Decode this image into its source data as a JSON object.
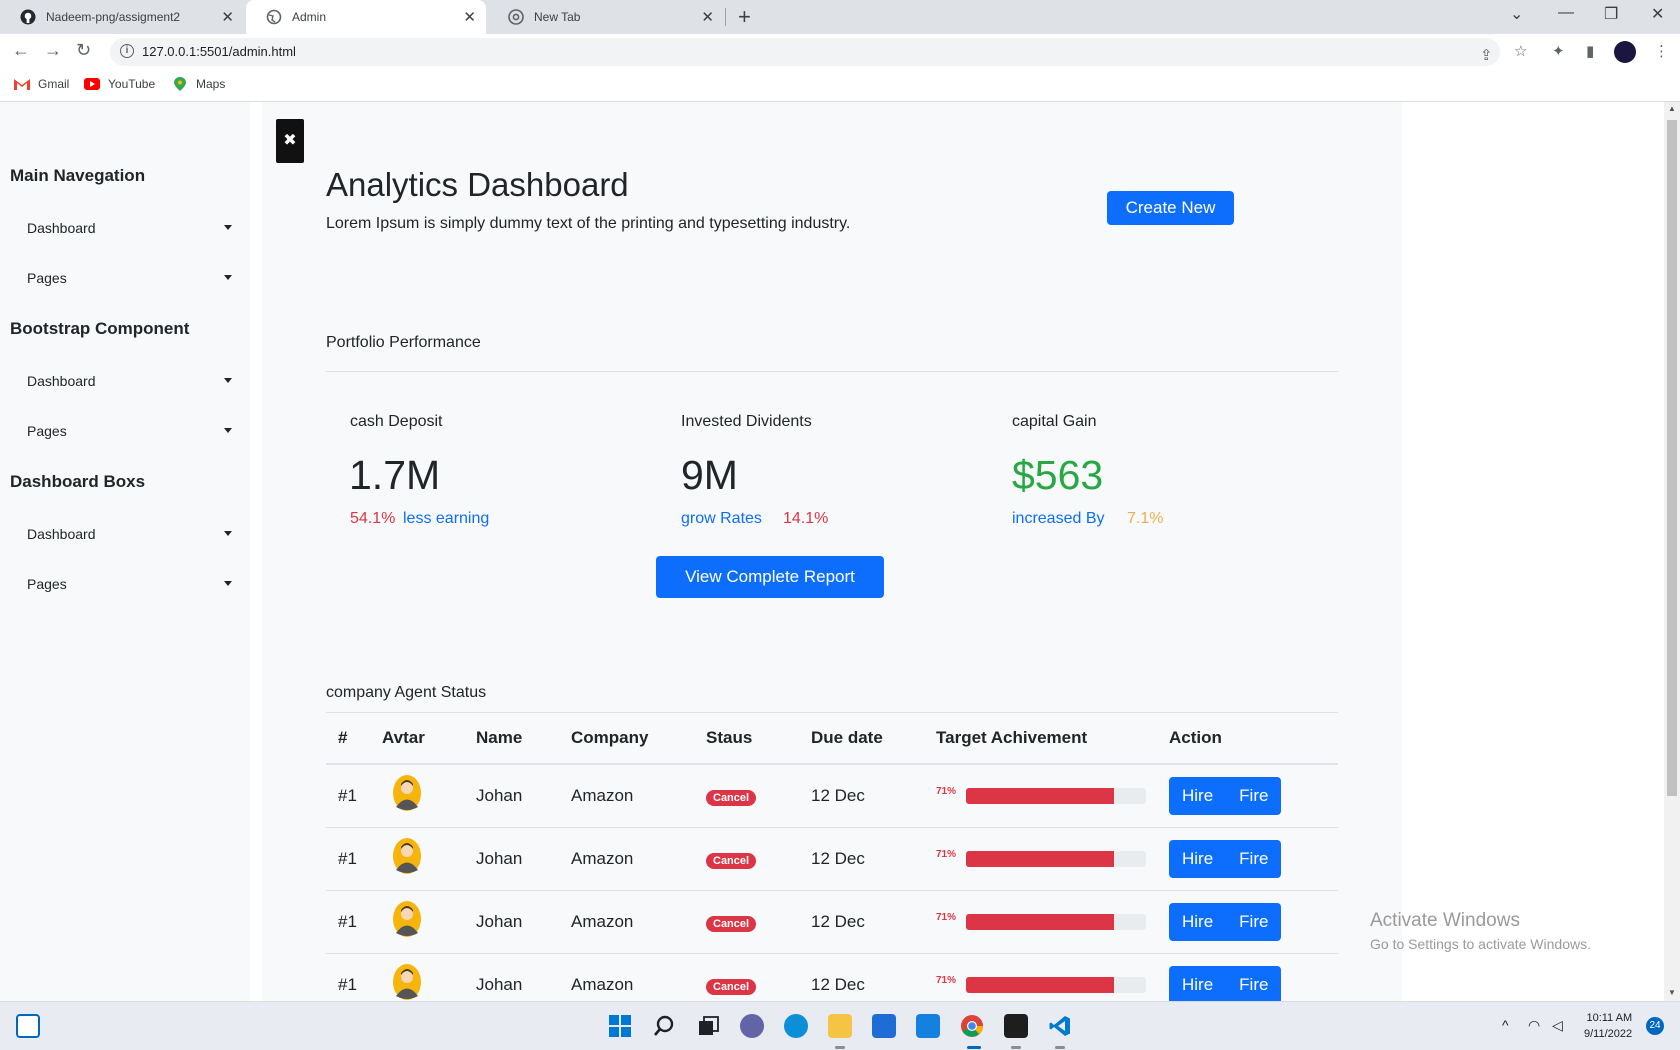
{
  "browser": {
    "tabs": [
      {
        "title": "Nadeem-png/assigment2",
        "icon": "github-icon"
      },
      {
        "title": "Admin",
        "icon": "globe-icon"
      },
      {
        "title": "New Tab",
        "icon": "chrome-icon"
      }
    ],
    "url": "127.0.0.1:5501/admin.html",
    "bookmarks": [
      {
        "label": "Gmail",
        "icon": "gmail-icon"
      },
      {
        "label": "YouTube",
        "icon": "youtube-icon"
      },
      {
        "label": "Maps",
        "icon": "maps-icon"
      }
    ]
  },
  "sidebar": {
    "sections": [
      {
        "heading": "Main Navegation",
        "items": [
          "Dashboard",
          "Pages"
        ]
      },
      {
        "heading": "Bootstrap Component",
        "items": [
          "Dashboard",
          "Pages"
        ]
      },
      {
        "heading": "Dashboard Boxs",
        "items": [
          "Dashboard",
          "Pages"
        ]
      }
    ]
  },
  "header": {
    "close_icon": "✖",
    "title": "Analytics Dashboard",
    "subtitle": "Lorem Ipsum is simply dummy text of the printing and typesetting industry.",
    "create_button": "Create New"
  },
  "portfolio": {
    "title": "Portfolio Performance",
    "stats": [
      {
        "label": "cash Deposit",
        "value": "1.7M",
        "sub_a": "54.1%",
        "sub_b": "less earning"
      },
      {
        "label": "Invested Dividents",
        "value": "9M",
        "sub_a": "grow Rates",
        "sub_b": "14.1%"
      },
      {
        "label": "capital Gain",
        "value": "$563",
        "sub_a": "increased By",
        "sub_b": "7.1%"
      }
    ],
    "report_button": "View Complete Report"
  },
  "agents": {
    "title": "company Agent Status",
    "columns": [
      "#",
      "Avtar",
      "Name",
      "Company",
      "Staus",
      "Due date",
      "Target Achivement",
      "Action"
    ],
    "rows": [
      {
        "num": "#1",
        "name": "Johan",
        "company": "Amazon",
        "status": "Cancel",
        "due": "12 Dec",
        "target_label": "71%",
        "target_fraction": 0.82,
        "hire": "Hire",
        "fire": "Fire"
      },
      {
        "num": "#1",
        "name": "Johan",
        "company": "Amazon",
        "status": "Cancel",
        "due": "12 Dec",
        "target_label": "71%",
        "target_fraction": 0.82,
        "hire": "Hire",
        "fire": "Fire"
      },
      {
        "num": "#1",
        "name": "Johan",
        "company": "Amazon",
        "status": "Cancel",
        "due": "12 Dec",
        "target_label": "71%",
        "target_fraction": 0.82,
        "hire": "Hire",
        "fire": "Fire"
      },
      {
        "num": "#1",
        "name": "Johan",
        "company": "Amazon",
        "status": "Cancel",
        "due": "12 Dec",
        "target_label": "71%",
        "target_fraction": 0.82,
        "hire": "Hire",
        "fire": "Fire"
      }
    ]
  },
  "watermark": {
    "line1": "Activate Windows",
    "line2": "Go to Settings to activate Windows."
  },
  "taskbar": {
    "time": "10:11 AM",
    "date": "9/11/2022",
    "notifications": "24"
  },
  "colors": {
    "primary": "#0d6efd",
    "danger": "#dc3545",
    "success": "#28a745",
    "warning": "#f0ad4e"
  }
}
